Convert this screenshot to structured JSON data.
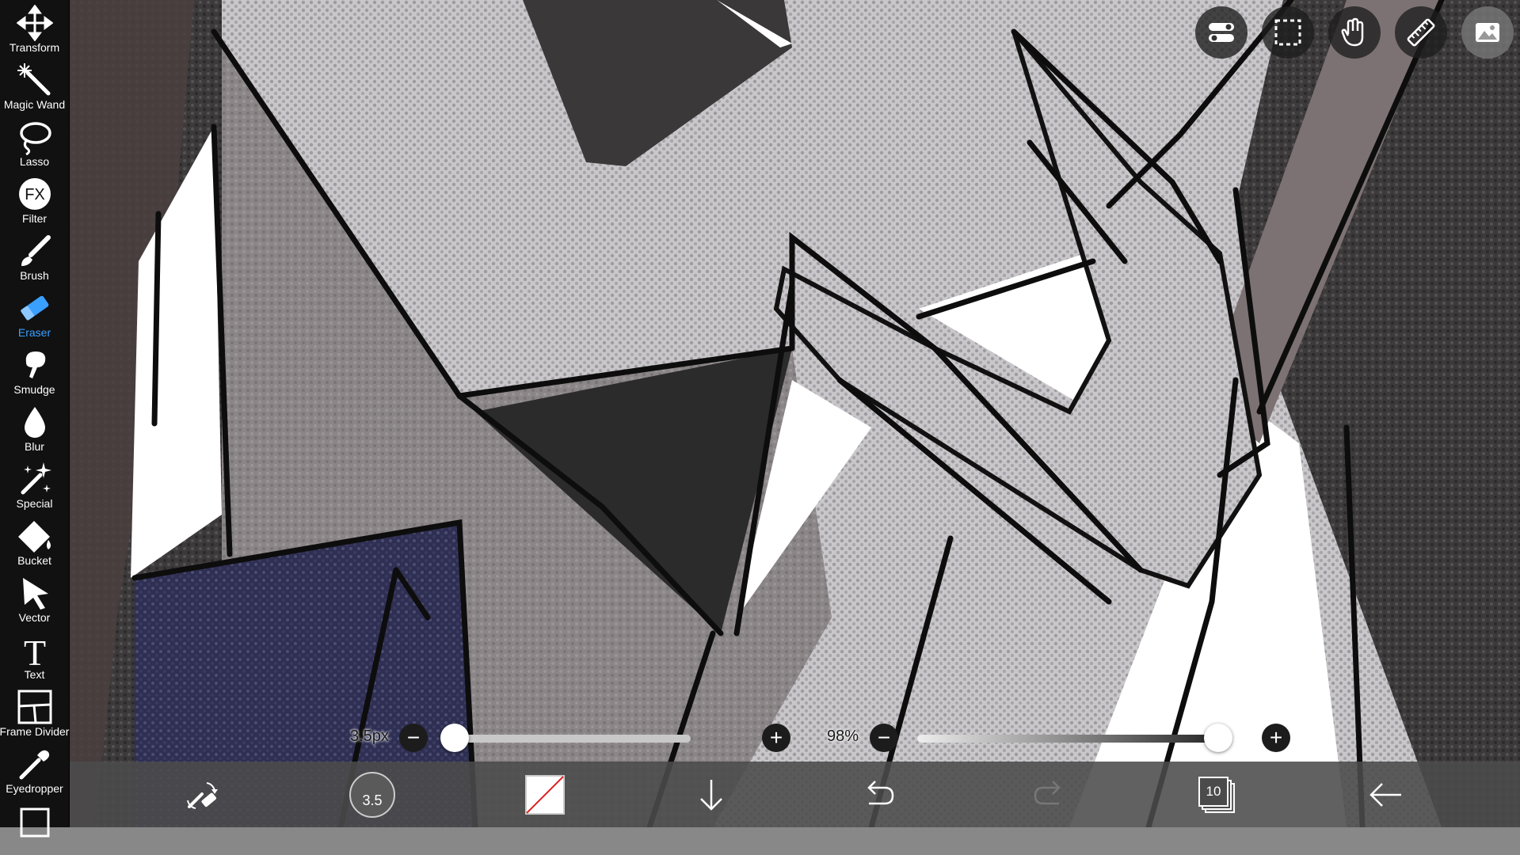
{
  "tools": [
    {
      "id": "transform",
      "label": "Transform",
      "icon": "move-arrows-icon"
    },
    {
      "id": "magic-wand",
      "label": "Magic Wand",
      "icon": "magic-wand-icon"
    },
    {
      "id": "lasso",
      "label": "Lasso",
      "icon": "lasso-icon"
    },
    {
      "id": "filter",
      "label": "Filter",
      "icon": "fx-icon"
    },
    {
      "id": "brush",
      "label": "Brush",
      "icon": "brush-icon"
    },
    {
      "id": "eraser",
      "label": "Eraser",
      "icon": "eraser-icon",
      "active": true
    },
    {
      "id": "smudge",
      "label": "Smudge",
      "icon": "smudge-icon"
    },
    {
      "id": "blur",
      "label": "Blur",
      "icon": "droplet-icon"
    },
    {
      "id": "special",
      "label": "Special",
      "icon": "sparkle-icon"
    },
    {
      "id": "bucket",
      "label": "Bucket",
      "icon": "bucket-icon"
    },
    {
      "id": "vector",
      "label": "Vector",
      "icon": "cursor-arrow-icon"
    },
    {
      "id": "text",
      "label": "Text",
      "icon": "text-icon"
    },
    {
      "id": "frame-divider",
      "label": "Frame Divider",
      "icon": "frame-divider-icon"
    },
    {
      "id": "eyedropper",
      "label": "Eyedropper",
      "icon": "eyedropper-icon"
    }
  ],
  "top_buttons": [
    "toggle-settings-icon",
    "selection-icon",
    "hand-icon",
    "ruler-icon",
    "material-icon"
  ],
  "sliders": {
    "size_label": "3.5px",
    "size_value": 0.04,
    "opacity_label": "98%",
    "opacity_value": 0.98
  },
  "bottom": {
    "brush_size": "3.5",
    "layer_count": "10",
    "color": "transparent"
  },
  "colors": {
    "accent": "#3aa0ff",
    "toolbar_bg": "#111111",
    "bottom_bg": "#4b4b4b"
  }
}
